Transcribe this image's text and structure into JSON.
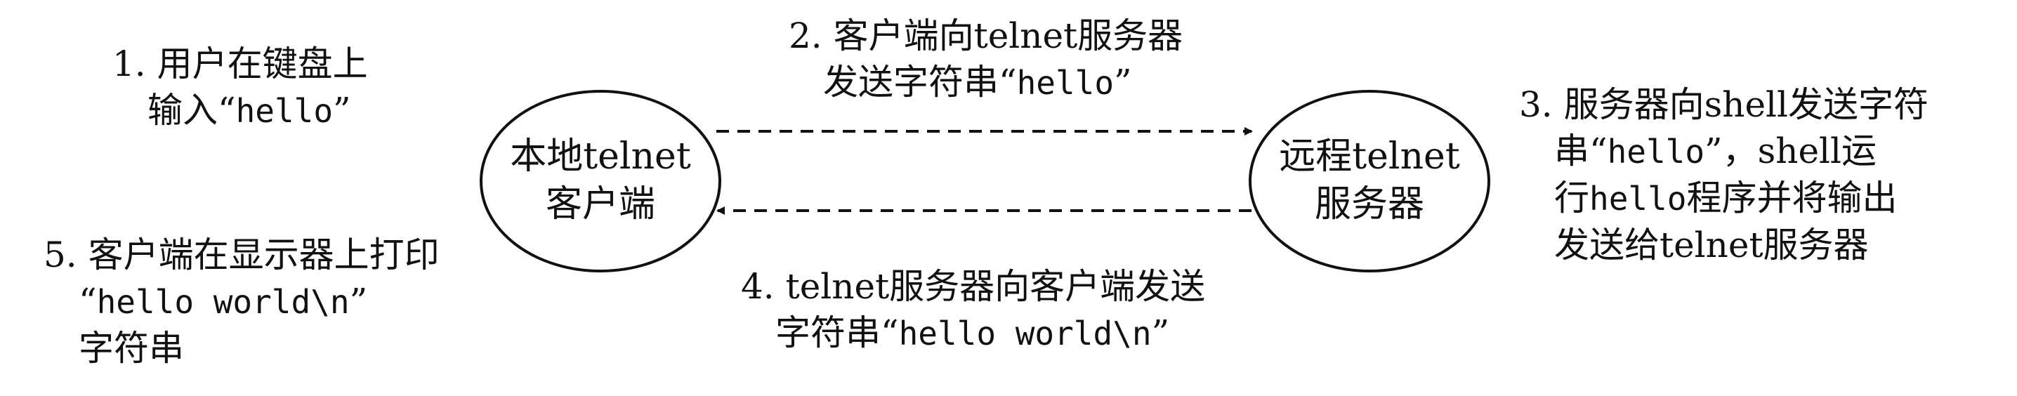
{
  "nodes": {
    "local": {
      "line1": "本地telnet",
      "line2": "客户端"
    },
    "remote": {
      "line1": "远程telnet",
      "line2": "服务器"
    }
  },
  "steps": {
    "step1": {
      "line1": "1. 用户在键盘上",
      "line2_prefix": "输入“",
      "line2_code": "hello",
      "line2_suffix": "”"
    },
    "step2": {
      "line1": "2. 客户端向telnet服务器",
      "line2_prefix": "发送字符串“",
      "line2_code": "hello",
      "line2_suffix": "”"
    },
    "step3": {
      "line1": "3. 服务器向shell发送字符",
      "line2_prefix": "串“",
      "line2_code": "hello",
      "line2_suffix": "”，shell运",
      "line3_prefix": "行",
      "line3_code": "hello",
      "line3_suffix": "程序并将输出",
      "line4": "发送给telnet服务器"
    },
    "step4": {
      "line1": "4. telnet服务器向客户端发送",
      "line2_prefix": "字符串“",
      "line2_code": "hello world\\n",
      "line2_suffix": "”"
    },
    "step5": {
      "line1": "5. 客户端在显示器上打印",
      "line2_prefix": "“",
      "line2_code": "hello world\\n",
      "line2_suffix": "”",
      "line3": "字符串"
    }
  }
}
